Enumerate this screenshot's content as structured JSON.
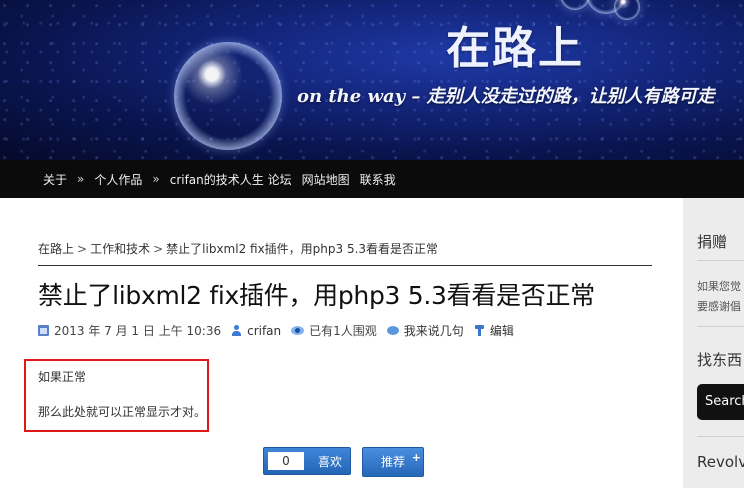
{
  "site": {
    "title": "在路上",
    "tagline": "on the way – 走别人没走过的路，让别人有路可走"
  },
  "nav": {
    "items": [
      "关于",
      "个人作品",
      "crifan的技术人生 论坛",
      "网站地图",
      "联系我"
    ],
    "separator": "»"
  },
  "breadcrumb": {
    "items": [
      "在路上",
      "工作和技术",
      "禁止了libxml2 fix插件，用php3 5.3看看是否正常"
    ],
    "separator": ">"
  },
  "post": {
    "title": "禁止了libxml2 fix插件，用php3 5.3看看是否正常",
    "date": "2013 年 7 月 1 日 上午 10:36",
    "author": "crifan",
    "views": "已有1人围观",
    "comment": "我来说几句",
    "edit": "编辑",
    "paragraphs": [
      "如果正常",
      "那么此处就可以正常显示才对。"
    ]
  },
  "actions": {
    "like_count": "0",
    "like_label": "喜欢",
    "recommend_label": "推荐",
    "recommend_plus": "+"
  },
  "sidebar": {
    "donate_heading": "捐赠",
    "donate_line1": "如果您觉",
    "donate_line2": "要感谢倡",
    "find_heading": "找东西",
    "search_button": "Search",
    "revolver_heading": "Revolv"
  },
  "colors": {
    "nav_bg": "#0b0b0b",
    "highlight_border": "#e01818",
    "button_blue": "#2f74c8"
  }
}
